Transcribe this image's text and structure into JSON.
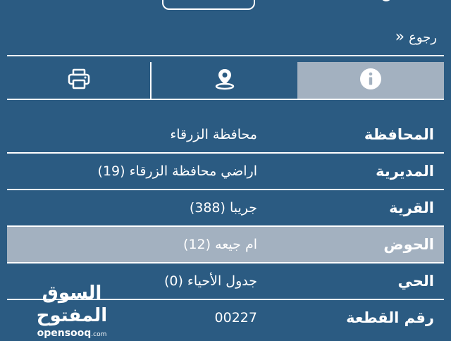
{
  "back_label": "رجوع",
  "tabs": [
    {
      "name": "print",
      "icon": "printer-icon"
    },
    {
      "name": "map",
      "icon": "map-pin-icon"
    },
    {
      "name": "info",
      "icon": "info-icon",
      "active": true
    }
  ],
  "rows": [
    {
      "label": "المحافظة",
      "value": "محافظة الزرقاء"
    },
    {
      "label": "المديرية",
      "value": "اراضي محافظة الزرقاء (19)"
    },
    {
      "label": "القرية",
      "value": "جريبا (388)"
    },
    {
      "label": "الحوض",
      "value": "ام جيعه (12)",
      "highlighted": true
    },
    {
      "label": "الحي",
      "value": "جدول الأحياء (0)"
    },
    {
      "label": "رقم القطعة",
      "value": "00227"
    }
  ],
  "logo": {
    "arabic": "السوق المفتوح",
    "latin": "opensooq",
    "domain": ".com"
  },
  "colors": {
    "background": "#2b5b82",
    "highlight": "#a3b1c0",
    "foreground": "#ffffff"
  }
}
